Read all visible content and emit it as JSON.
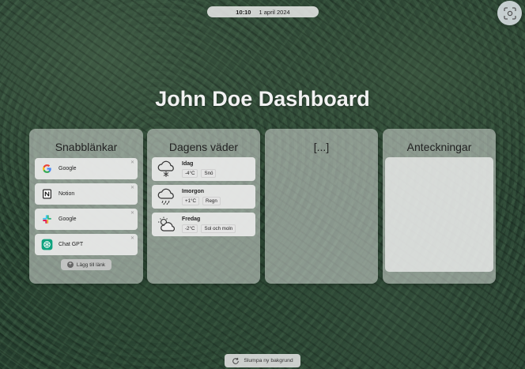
{
  "header": {
    "time": "10:10",
    "date": "1 april 2024",
    "title": "John Doe Dashboard"
  },
  "quick_links": {
    "heading": "Snabblänkar",
    "items": [
      {
        "label": "Google",
        "icon": "google-icon"
      },
      {
        "label": "Notion",
        "icon": "notion-icon"
      },
      {
        "label": "Google",
        "icon": "slack-icon"
      },
      {
        "label": "Chat GPT",
        "icon": "chatgpt-icon"
      }
    ],
    "add_label": "Lägg till länk"
  },
  "weather": {
    "heading": "Dagens väder",
    "items": [
      {
        "day": "Idag",
        "temp": "-4°C",
        "condition": "Snö",
        "icon": "snow-cloud-icon"
      },
      {
        "day": "Imorgon",
        "temp": "+1°C",
        "condition": "Regn",
        "icon": "rain-cloud-icon"
      },
      {
        "day": "Fredag",
        "temp": "-2°C",
        "condition": "Sol och moln",
        "icon": "partly-cloudy-icon"
      }
    ]
  },
  "placeholder_panel": {
    "heading": "[...]"
  },
  "notes": {
    "heading": "Anteckningar",
    "content": ""
  },
  "footer": {
    "randomize_label": "Slumpa ny bakgrund",
    "icon": "refresh-icon"
  },
  "colors": {
    "panel_bg": "#d7dad7",
    "title_text": "#f2f2f2",
    "google_blue": "#4285F4",
    "chatgpt_green": "#10a37f"
  }
}
